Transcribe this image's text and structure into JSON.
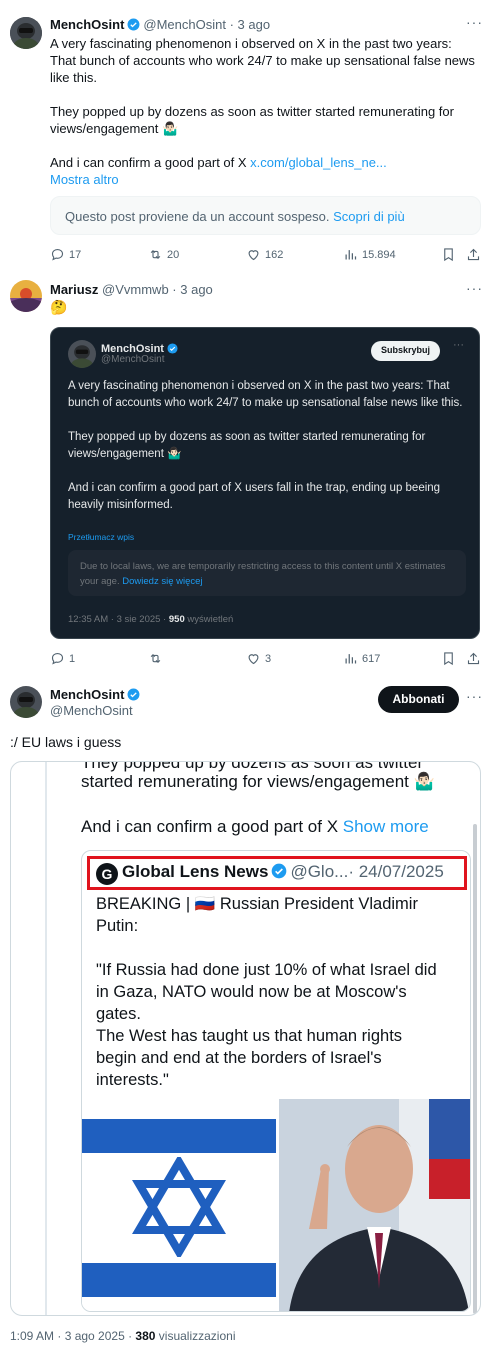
{
  "post1": {
    "name": "MenchOsint",
    "handle": "@MenchOsint",
    "time": "3 ago",
    "more": "···",
    "text_p1": "A very fascinating phenomenon i observed on X in the past two years: That bunch of accounts who work 24/7 to make up sensational false news like this.",
    "text_p2": "They popped up by dozens as soon as twitter started remunerating for views/engagement 🤷🏻‍♂️",
    "text_p3_prefix": "And i can confirm a good part of X ",
    "text_p3_link": "x.com/global_lens_ne...",
    "show_more": "Mostra altro",
    "notice_text": "Questo post proviene da un account sospeso.",
    "notice_link": "Scopri di più",
    "replies": "17",
    "reposts": "20",
    "likes": "162",
    "views": "15.894"
  },
  "post2": {
    "name": "Mariusz",
    "handle": "@Vvmmwb",
    "time": "3 ago",
    "more": "···",
    "text": "🤔",
    "card": {
      "name": "MenchOsint",
      "handle": "@MenchOsint",
      "subscribe": "Subskrybuj",
      "more": "···",
      "text_p1": "A very fascinating phenomenon i observed on X in the past two years: That bunch of accounts who work 24/7 to make up sensational false news like this.",
      "text_p2": "They popped up by dozens as soon as twitter started remunerating for views/engagement 🤷🏻‍♂️",
      "text_p3": "And i can confirm a good part of X users fall in the trap, ending up beeing heavily misinformed.",
      "translate": "Przetłumacz wpis",
      "notice_text": "Due to local laws, we are temporarily restricting access to this content until X estimates your age.",
      "notice_link": "Dowiedz się więcej",
      "meta_time": "12:35 AM · 3 sie 2025 · ",
      "meta_views": "950",
      "meta_views_label": " wyświetleń"
    },
    "replies": "1",
    "reposts": "",
    "likes": "3",
    "views": "617"
  },
  "post3": {
    "name": "MenchOsint",
    "handle": "@MenchOsint",
    "subscribe": "Abbonati",
    "more": "···",
    "text": ":/ EU laws i guess",
    "media": {
      "cut_text": "They popped up by dozens as soon as twitter",
      "line2": "started remunerating for views/engagement 🤷🏻‍♂️",
      "line3_prefix": "And i can confirm a good part of X ",
      "line3_link": "Show more",
      "inner": {
        "logo_letter": "G",
        "name": "Global Lens News",
        "handle": "@Glo...",
        "date": "· 24/07/2025",
        "line1": "BREAKING | 🇷🇺 Russian President Vladimir",
        "line2": "Putin:",
        "quote1": "\"If Russia had done just 10% of what Israel did",
        "quote2": "in Gaza, NATO would now be at Moscow's",
        "quote3": "gates.",
        "quote4": "The West has taught us that human rights",
        "quote5": "begin and end at the borders of Israel's",
        "quote6": "interests.\""
      }
    },
    "meta_time": "1:09 AM · 3 ago 2025 · ",
    "meta_views": "380",
    "meta_views_label": " visualizzazioni"
  },
  "colors": {
    "accent": "#1d9bf0",
    "muted": "#536471",
    "dark_bg": "#15202b",
    "red_box": "#e0141e"
  }
}
